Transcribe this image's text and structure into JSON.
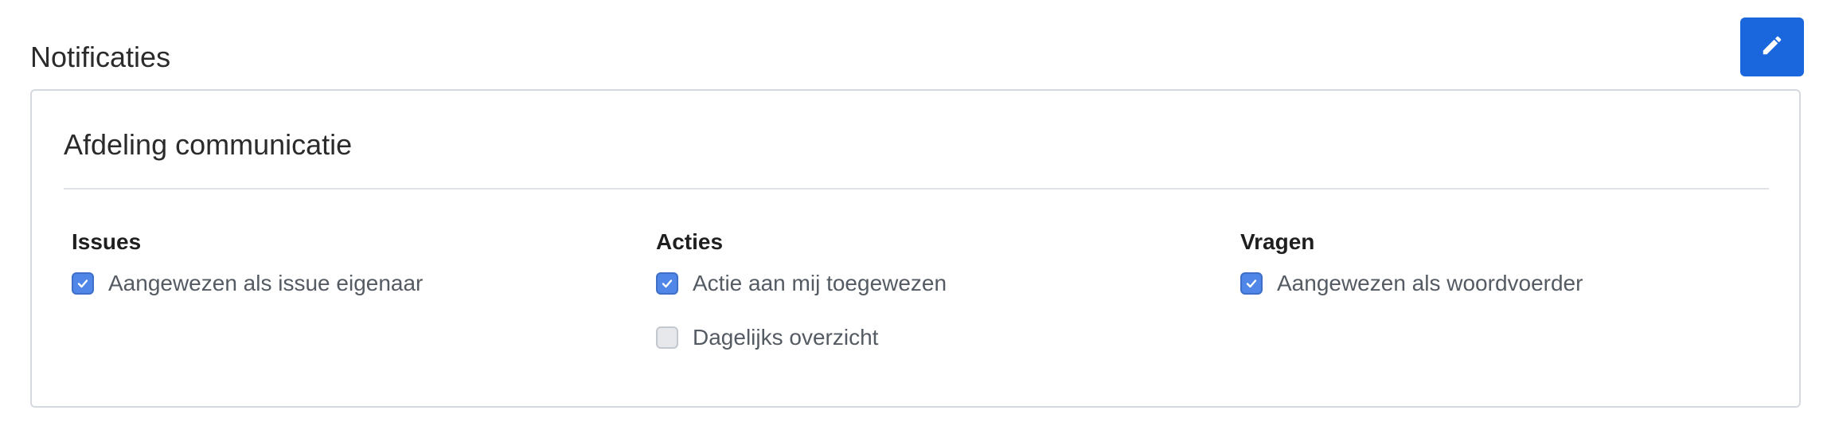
{
  "header": {
    "title": "Notificaties",
    "edit_icon": "pencil-icon",
    "edit_button_color": "#1a66dd"
  },
  "panel": {
    "title": "Afdeling communicatie",
    "columns": [
      {
        "heading": "Issues",
        "options": [
          {
            "label": "Aangewezen als issue eigenaar",
            "checked": true
          }
        ]
      },
      {
        "heading": "Acties",
        "options": [
          {
            "label": "Actie aan mij toegewezen",
            "checked": true
          },
          {
            "label": "Dagelijks overzicht",
            "checked": false
          }
        ]
      },
      {
        "heading": "Vragen",
        "options": [
          {
            "label": "Aangewezen als woordvoerder",
            "checked": true
          }
        ]
      }
    ]
  },
  "colors": {
    "checkbox_checked": "#4f86e8",
    "checkbox_unchecked": "#e6e8ec",
    "panel_border": "#d5d9de"
  }
}
